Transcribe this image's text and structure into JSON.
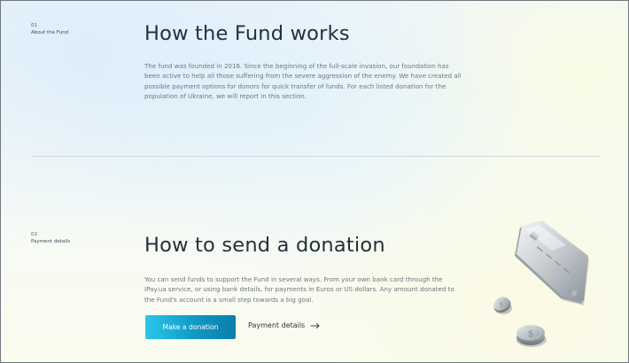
{
  "section1": {
    "number": "01",
    "label": "About the Fund",
    "title": "How the Fund works",
    "paragraph_lines": [
      "The fund was founded in 2016. Since the beginning of the full-scale invasion, our foundation has",
      "been active to help all those suffering from the severe aggression of the enemy. We have created all",
      "possible payment options for donors for quick transfer of funds. For each listed donation for the",
      "population of Ukraine, we will report in this section."
    ]
  },
  "section2": {
    "number": "02",
    "label": "Payment details",
    "title": "How to send a donation",
    "paragraph_lines": [
      "You can send funds to support the Fund in several ways. From your own bank card through the",
      "IPay.ua service, or using bank details, for payments in Euros or US dollars. Any amount donated to",
      "the Fund's account is a small step towards a big goal."
    ],
    "primary_button": "Make a donation",
    "secondary_link": "Payment details"
  },
  "icons": {
    "arrow": "arrow-right-icon",
    "illustration": "bank-card-and-coins-illustration"
  },
  "colors": {
    "accent_start": "#2ac7ea",
    "accent_end": "#0a7fa8",
    "heading": "#24303a",
    "body_text": "#6d777c"
  }
}
